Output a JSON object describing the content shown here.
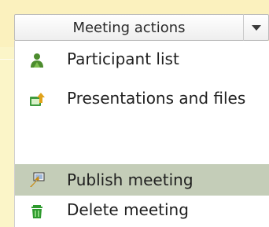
{
  "dropdown": {
    "label": "Meeting actions",
    "arrow_icon": "chevron-down-icon"
  },
  "menu": {
    "items": [
      {
        "label": "Participant list",
        "icon": "participants-icon",
        "icon_color": "#4C8C2E"
      },
      {
        "label": "Presentations and files",
        "icon": "presentations-upload-icon",
        "icon_color": "#E0A21A"
      },
      {
        "label": "Publish meeting",
        "icon": "publish-icon",
        "icon_color": "#C98A11",
        "highlighted": true
      },
      {
        "label": "Delete meeting",
        "icon": "trash-icon",
        "icon_color": "#2E9A2E"
      }
    ]
  },
  "colors": {
    "background": "#FBF5C8",
    "highlight": "#C4CDB8",
    "menu_bg": "#FFFFFF",
    "text": "#1F1F1F"
  }
}
